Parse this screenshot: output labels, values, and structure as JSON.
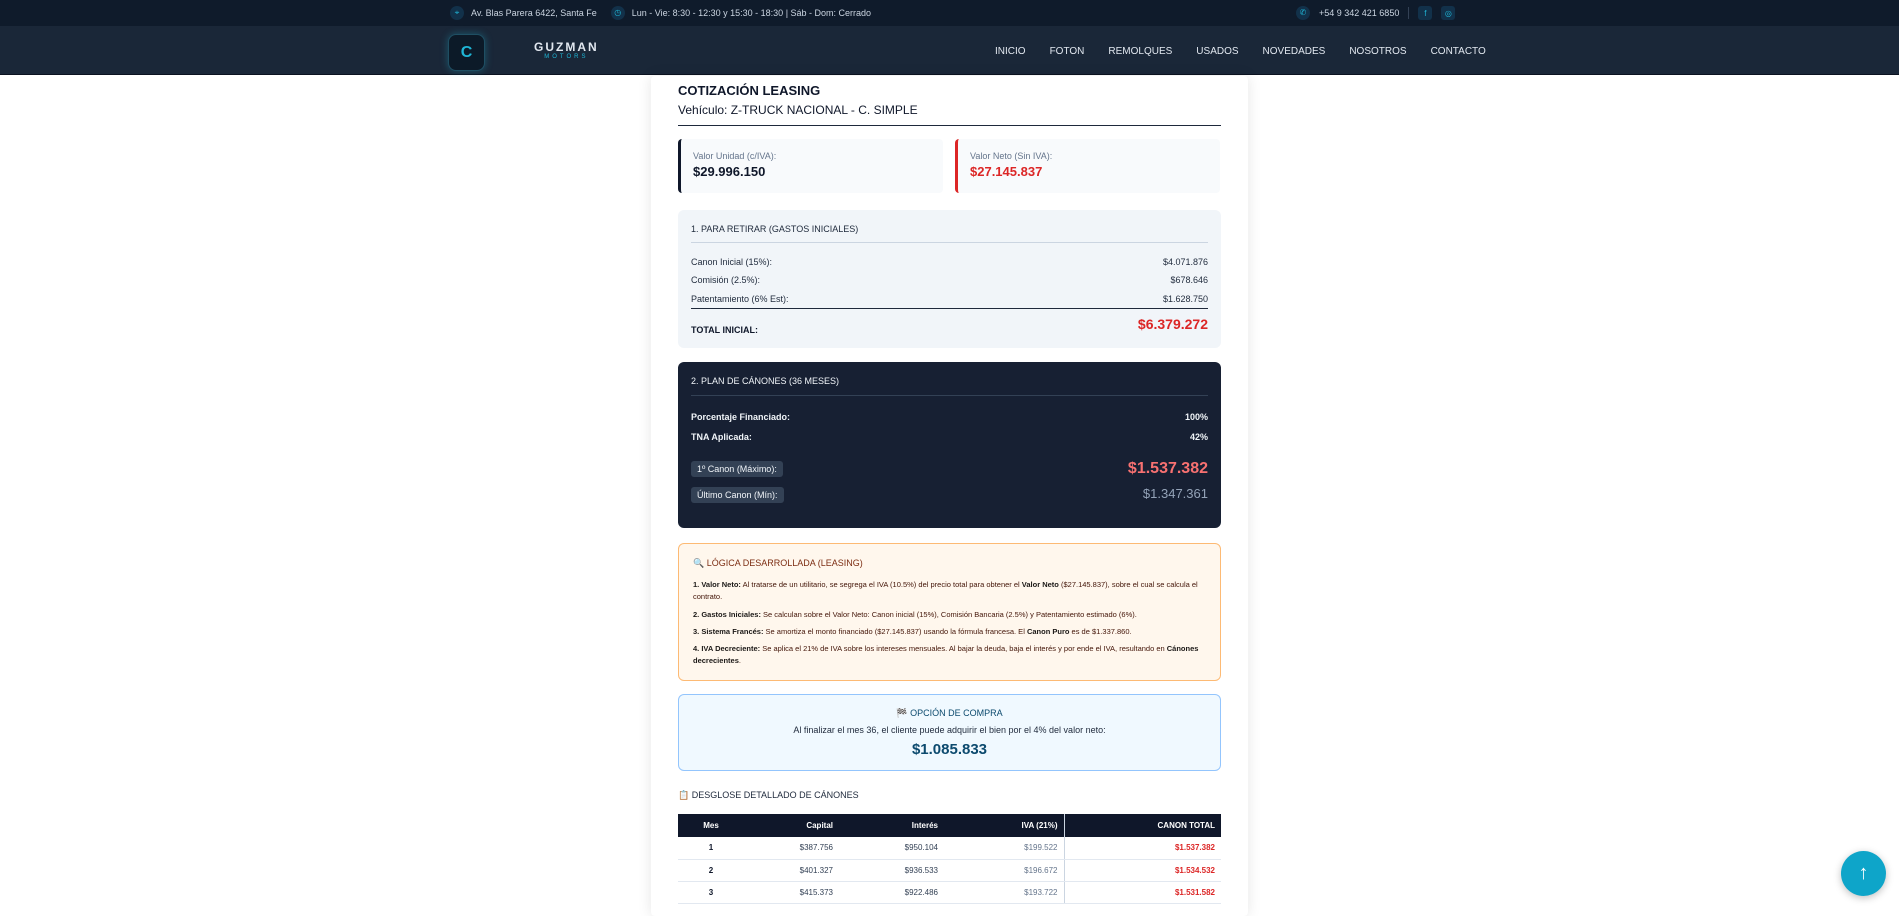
{
  "topbar": {
    "address": "Av. Blas Parera 6422, Santa Fe",
    "hours": "Lun - Vie: 8:30 - 12:30 y 15:30 - 18:30 | Sáb - Dom: Cerrado",
    "phone": "+54 9 342 421 6850"
  },
  "brand": {
    "name": "GUZMAN",
    "tag": "MOTORS"
  },
  "menu": [
    "INICIO",
    "FOTON",
    "REMOLQUES",
    "USADOS",
    "NOVEDADES",
    "NOSOTROS",
    "CONTACTO"
  ],
  "quote": {
    "title": "COTIZACIÓN LEASING",
    "vehicle": "Vehículo: Z-TRUCK NACIONAL - C. SIMPLE",
    "unit_label": "Valor Unidad (c/IVA):",
    "unit_value": "$29.996.150",
    "net_label": "Valor Neto (Sin IVA):",
    "net_value": "$27.145.837"
  },
  "initial": {
    "heading": "1. PARA RETIRAR (GASTOS INICIALES)",
    "rows": [
      {
        "label": "Canon Inicial (15%):",
        "value": "$4.071.876"
      },
      {
        "label": "Comisión (2.5%):",
        "value": "$678.646"
      },
      {
        "label": "Patentamiento (6% Est):",
        "value": "$1.628.750"
      }
    ],
    "total_label": "TOTAL INICIAL:",
    "total_value": "$6.379.272"
  },
  "plan": {
    "heading": "2. PLAN DE CÁNONES (36 MESES)",
    "financed_label": "Porcentaje Financiado:",
    "financed_value": "100%",
    "tna_label": "TNA Aplicada:",
    "tna_value": "42%",
    "first_label": "1º Canon (Máximo):",
    "first_value": "$1.537.382",
    "last_label": "Último Canon (Mín):",
    "last_value": "$1.347.361"
  },
  "logic": {
    "heading": "🔍 LÓGICA DESARROLLADA (LEASING)",
    "p1_b": "1. Valor Neto:",
    "p1_t": " Al tratarse de un utilitario, se segrega el IVA (10.5%) del precio total para obtener el ",
    "p1_b2": "Valor Neto",
    "p1_t2": " ($27.145.837), sobre el cual se calcula el contrato.",
    "p2_b": "2. Gastos Iniciales:",
    "p2_t": " Se calculan sobre el Valor Neto: Canon inicial (15%), Comisión Bancaria (2.5%) y Patentamiento estimado (6%).",
    "p3_b": "3. Sistema Francés:",
    "p3_t": " Se amortiza el monto financiado ($27.145.837) usando la fórmula francesa. El ",
    "p3_b2": "Canon Puro",
    "p3_t2": " es de $1.337.860.",
    "p4_b": "4. IVA Decreciente:",
    "p4_t": " Se aplica el 21% de IVA sobre los intereses mensuales. Al bajar la deuda, baja el interés y por ende el IVA, resultando en ",
    "p4_b2": "Cánones decrecientes",
    "p4_t2": "."
  },
  "option": {
    "heading": "🏁 OPCIÓN DE COMPRA",
    "text": "Al finalizar el mes 36, el cliente puede adquirir el bien por el 4% del valor neto:",
    "value": "$1.085.833"
  },
  "breakdown": {
    "heading": "📋 DESGLOSE DETALLADO DE CÁNONES",
    "headers": [
      "Mes",
      "Capital",
      "Interés",
      "IVA (21%)",
      "CANON TOTAL"
    ],
    "rows": [
      [
        "1",
        "$387.756",
        "$950.104",
        "$199.522",
        "$1.537.382"
      ],
      [
        "2",
        "$401.327",
        "$936.533",
        "$196.672",
        "$1.534.532"
      ],
      [
        "3",
        "$415.373",
        "$922.486",
        "$193.722",
        "$1.531.582"
      ]
    ]
  },
  "icons": {
    "accent": "#1fb6d6",
    "danger": "#dc2626"
  }
}
